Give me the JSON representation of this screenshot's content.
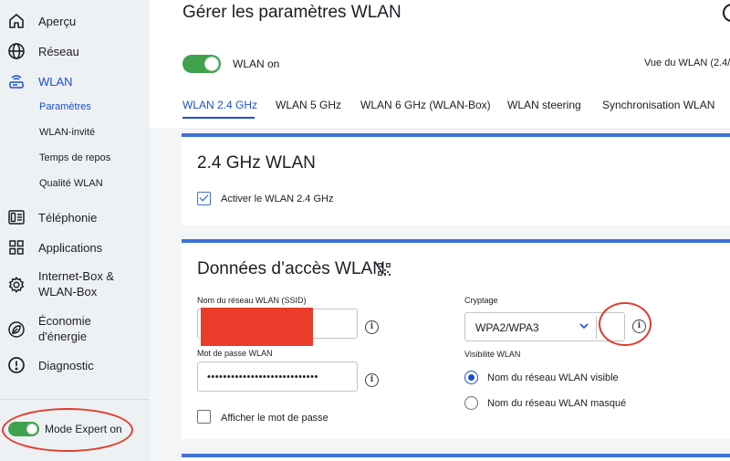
{
  "sidebar": {
    "items": [
      {
        "label": "Aperçu",
        "icon": "home-icon"
      },
      {
        "label": "Réseau",
        "icon": "globe-icon"
      },
      {
        "label": "WLAN",
        "icon": "router-icon",
        "active": true
      },
      {
        "label": "Téléphonie",
        "icon": "phone-icon"
      },
      {
        "label": "Applications",
        "icon": "apps-grid-icon"
      },
      {
        "label": "Internet-Box &",
        "label2": "WLAN-Box",
        "icon": "gear-icon"
      },
      {
        "label": "Économie",
        "label2": "d'énergie",
        "icon": "leaf-icon"
      },
      {
        "label": "Diagnostic",
        "icon": "alert-circle-icon"
      }
    ],
    "wlan_subitems": [
      {
        "label": "Paramètres",
        "active": true
      },
      {
        "label": "WLAN-invité"
      },
      {
        "label": "Temps de repos"
      },
      {
        "label": "Qualité WLAN"
      }
    ],
    "expert_mode_label": "Mode Expert on"
  },
  "main": {
    "title": "Gérer les paramètres WLAN",
    "wlan_toggle_label": "WLAN on",
    "view_link": "Vue du WLAN (2.4/",
    "tabs": [
      {
        "label": "WLAN 2.4 GHz",
        "active": true
      },
      {
        "label": "WLAN 5 GHz"
      },
      {
        "label": "WLAN 6 GHz (WLAN-Box)"
      },
      {
        "label": "WLAN steering"
      },
      {
        "label": "Synchronisation WLAN"
      }
    ]
  },
  "card_24ghz": {
    "title": "2.4 GHz WLAN",
    "enable_label": "Activer le WLAN 2.4 GHz",
    "enabled": true
  },
  "card_access": {
    "title": "Données d’accès WLAN",
    "ssid_label": "Nom du réseau WLAN (SSID)",
    "ssid_value": "",
    "password_label": "Mot de passe WLAN",
    "password_value": "••••••••••••••••••••••••••••",
    "show_password_label": "Afficher le mot de passe",
    "encryption_label": "Cryptage",
    "encryption_value": "WPA2/WPA3",
    "visibility_label": "Visibilité WLAN",
    "visibility_options": [
      {
        "label": "Nom du réseau WLAN visible",
        "selected": true
      },
      {
        "label": "Nom du réseau WLAN masqué",
        "selected": false
      }
    ]
  },
  "colors": {
    "accent": "#1a4fd6",
    "toggle_on": "#3fa34d",
    "annotation": "#e23b2c",
    "card_border": "#3e73d8"
  }
}
